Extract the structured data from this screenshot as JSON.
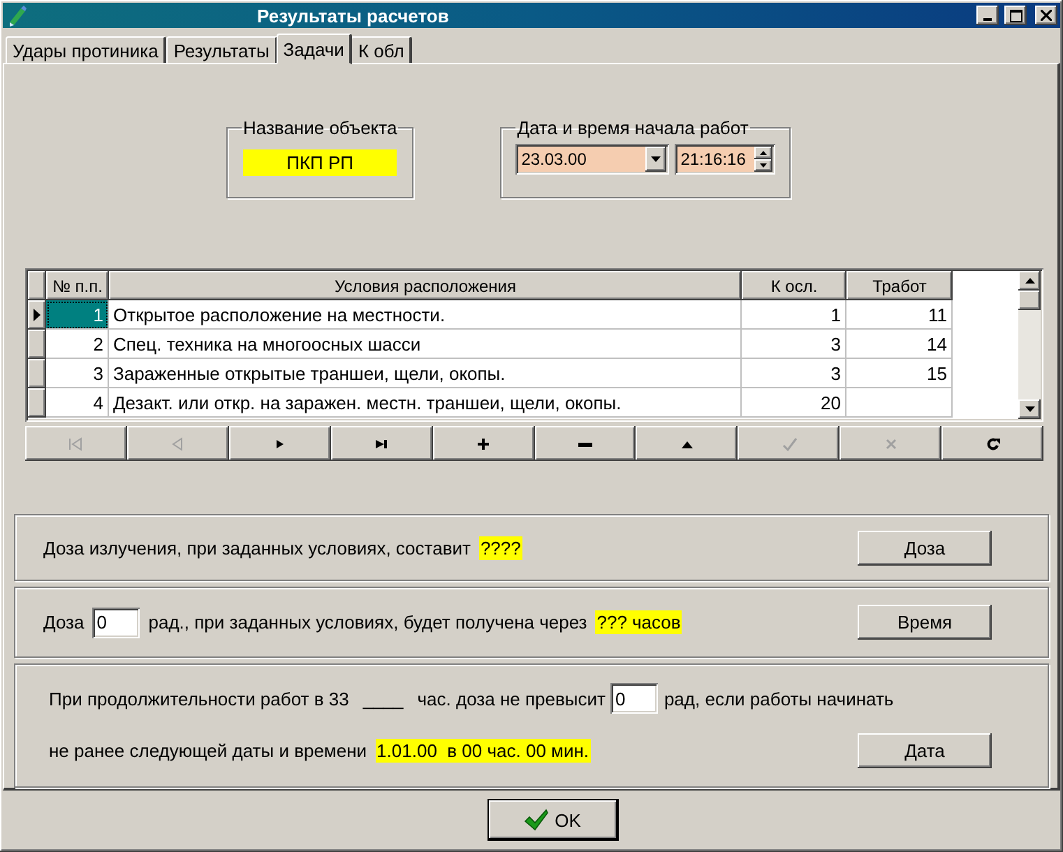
{
  "window": {
    "title": "Результаты расчетов"
  },
  "title_buttons": [
    {
      "kind": "minimize"
    },
    {
      "kind": "maximize"
    },
    {
      "kind": "close"
    }
  ],
  "tabs": [
    {
      "label": "Удары протиника",
      "selected": false
    },
    {
      "label": "Результаты",
      "selected": false
    },
    {
      "label": "Задачи",
      "selected": true
    },
    {
      "label": "К обл",
      "selected": false
    }
  ],
  "object_group": {
    "label": "Название объекта",
    "value": "ПКП РП"
  },
  "start_group": {
    "label": "Дата и время начала работ",
    "date": "23.03.00",
    "time": "21:16:16"
  },
  "table": {
    "columns": [
      "№ п.п.",
      "Условия расположения",
      "К осл.",
      "Тработ"
    ],
    "rows": [
      {
        "cells": [
          "1",
          "Открытое расположение на местности.",
          "1",
          "11"
        ],
        "selected": true
      },
      {
        "cells": [
          "2",
          "Спец. техника на многоосных шасси",
          "3",
          "14"
        ],
        "selected": false
      },
      {
        "cells": [
          "3",
          "Зараженные открытые траншеи, щели, окопы.",
          "3",
          "15"
        ],
        "selected": false
      },
      {
        "cells": [
          "4",
          "Дезакт. или  откр. на заражен. местн. траншеи, щели, окопы.",
          "20"
        ],
        "selected": false
      }
    ]
  },
  "navigator": [
    {
      "kind": "first",
      "disabled": true
    },
    {
      "kind": "prior",
      "disabled": true
    },
    {
      "kind": "next",
      "disabled": false
    },
    {
      "kind": "last",
      "disabled": false
    },
    {
      "kind": "insert",
      "disabled": false
    },
    {
      "kind": "delete",
      "disabled": false
    },
    {
      "kind": "edit",
      "disabled": false
    },
    {
      "kind": "post",
      "disabled": true
    },
    {
      "kind": "cancel",
      "disabled": true
    },
    {
      "kind": "refresh",
      "disabled": false
    }
  ],
  "dose_panel": {
    "text": "Доза излучения, при заданных условиях, составит",
    "result": "????",
    "button": "Доза"
  },
  "time_panel": {
    "label": "Доза",
    "value": "0",
    "text": "рад., при заданных условиях, будет получена через",
    "result": "??? часов",
    "button": "Время"
  },
  "date_panel": {
    "text_1": "При продолжительности работ в 33",
    "blank": "____",
    "text_2": "час. доза не превысит",
    "value": "0",
    "text_3": "рад, если работы начинать",
    "text_4": "не ранее следующей даты и времени",
    "result": "1.01.00  в 00 час. 00 мин.",
    "button": "Дата"
  },
  "ok_button": {
    "label": "OK"
  }
}
